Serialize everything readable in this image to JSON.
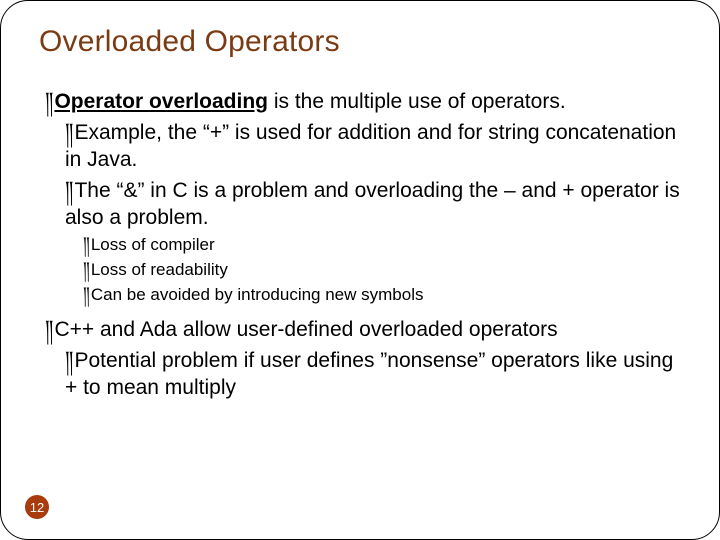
{
  "title": "Overloaded Operators",
  "bullet_glyph": "༎",
  "page_number": "12",
  "items": [
    {
      "level": 1,
      "runs": [
        {
          "text": "Operator overloading",
          "bold": true,
          "underline": true
        },
        {
          "text": " is the multiple use of operators."
        }
      ]
    },
    {
      "level": 2,
      "runs": [
        {
          "text": "Example, the “+” is used for addition and for string concatenation in Java."
        }
      ]
    },
    {
      "level": 2,
      "runs": [
        {
          "text": "The “&” in C is a problem and overloading the – and + operator is also a problem."
        }
      ]
    },
    {
      "level": 3,
      "runs": [
        {
          "text": "Loss of compiler"
        }
      ]
    },
    {
      "level": 3,
      "runs": [
        {
          "text": "Loss of readability"
        }
      ]
    },
    {
      "level": 3,
      "runs": [
        {
          "text": "Can be avoided by introducing new symbols"
        }
      ]
    },
    {
      "level": 1,
      "runs": [
        {
          "text": "C++ and Ada allow user-defined overloaded operators"
        }
      ]
    },
    {
      "level": 2,
      "runs": [
        {
          "text": "Potential problem if user defines ”nonsense” operators like using + to mean multiply"
        }
      ]
    }
  ]
}
